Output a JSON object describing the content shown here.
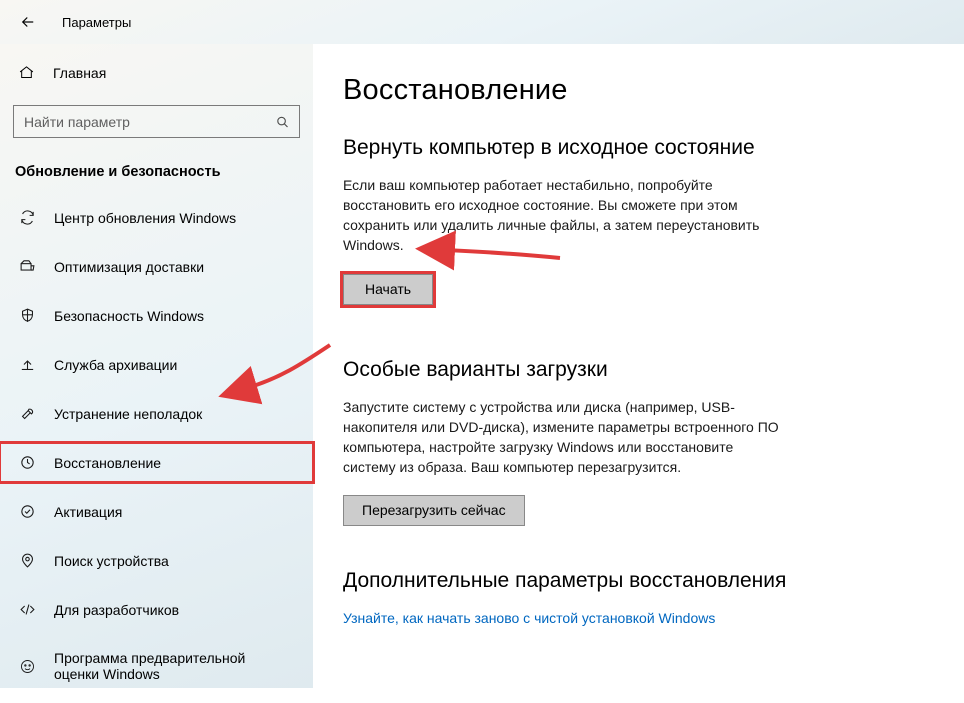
{
  "window": {
    "title": "Параметры"
  },
  "sidebar": {
    "home_label": "Главная",
    "search_placeholder": "Найти параметр",
    "category": "Обновление и безопасность",
    "items": [
      {
        "icon": "sync-icon",
        "label": "Центр обновления Windows"
      },
      {
        "icon": "delivery-icon",
        "label": "Оптимизация доставки"
      },
      {
        "icon": "shield-icon",
        "label": "Безопасность Windows"
      },
      {
        "icon": "backup-icon",
        "label": "Служба архивации"
      },
      {
        "icon": "troubleshoot-icon",
        "label": "Устранение неполадок"
      },
      {
        "icon": "recovery-icon",
        "label": "Восстановление"
      },
      {
        "icon": "activation-icon",
        "label": "Активация"
      },
      {
        "icon": "find-device-icon",
        "label": "Поиск устройства"
      },
      {
        "icon": "developer-icon",
        "label": "Для разработчиков"
      },
      {
        "icon": "insider-icon",
        "label": "Программа предварительной оценки Windows"
      }
    ]
  },
  "main": {
    "page_title": "Восстановление",
    "sections": [
      {
        "title": "Вернуть компьютер в исходное состояние",
        "text": "Если ваш компьютер работает нестабильно, попробуйте восстановить его исходное состояние. Вы сможете при этом сохранить или удалить личные файлы, а затем переустановить Windows.",
        "button": "Начать"
      },
      {
        "title": "Особые варианты загрузки",
        "text": "Запустите систему с устройства или диска (например, USB-накопителя или DVD-диска), измените параметры встроенного ПО компьютера, настройте загрузку Windows или восстановите систему из образа. Ваш компьютер перезагрузится.",
        "button": "Перезагрузить сейчас"
      },
      {
        "title": "Дополнительные параметры восстановления",
        "link": "Узнайте, как начать заново с чистой установкой Windows"
      }
    ]
  }
}
